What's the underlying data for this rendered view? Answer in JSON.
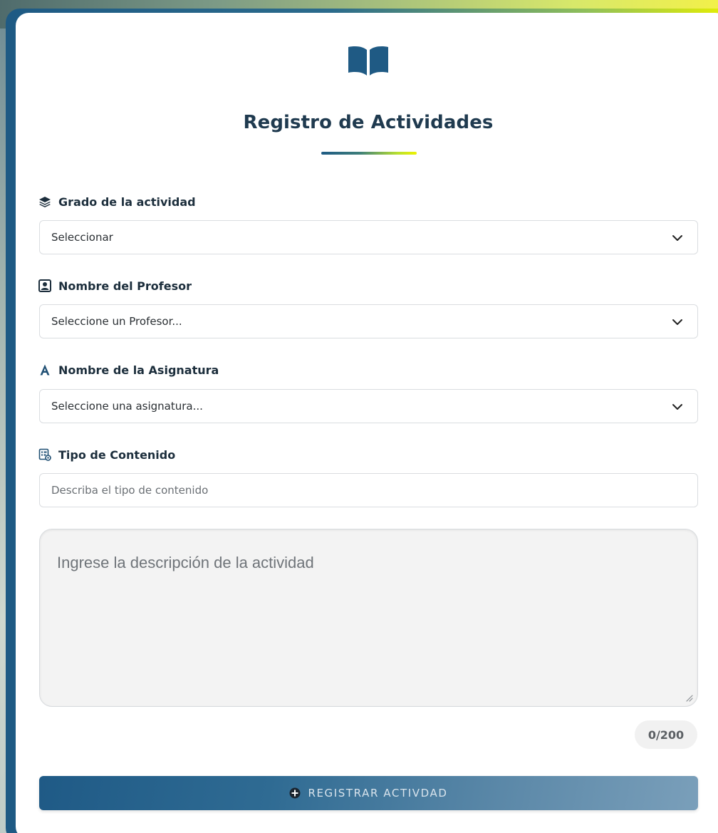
{
  "header": {
    "icon": "book-open-icon",
    "title": "Registro de Actividades"
  },
  "fields": {
    "grado": {
      "label": "Grado de la actividad",
      "icon": "layers-icon",
      "value": "Seleccionar"
    },
    "profesor": {
      "label": "Nombre del Profesor",
      "icon": "user-square-icon",
      "value": "Seleccione un Profesor..."
    },
    "asignatura": {
      "label": "Nombre de la Asignatura",
      "icon": "font-a-icon",
      "value": "Seleccione una asignatura..."
    },
    "contenido": {
      "label": "Tipo de Contenido",
      "icon": "list-gear-icon",
      "placeholder": "Describa el tipo de contenido"
    },
    "descripcion": {
      "placeholder": "Ingrese la descripción de la actividad",
      "counter": "0/200"
    }
  },
  "submit": {
    "icon": "plus-circle-icon",
    "label": "REGISTRAR ACTIVDAD"
  },
  "colors": {
    "primary": "#1f4f73",
    "accent_yellow": "#eef200",
    "text_dark": "#1c2e3c"
  }
}
